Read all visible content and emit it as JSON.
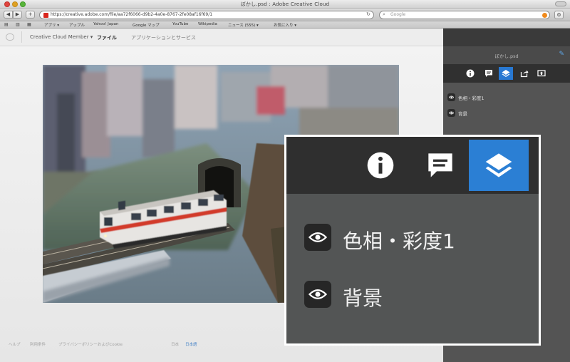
{
  "window": {
    "title": "ぼかし.psd : Adobe Creative Cloud"
  },
  "browser": {
    "url": "https://creative.adobe.com/file/aa72f6066-d9b2-4a0e-8767-2fe08af16f69/1",
    "search_placeholder": "Google"
  },
  "bookmarks": [
    "アプリ ▾",
    "アップル",
    "Yahoo! Japan",
    "Google マップ",
    "YouTube",
    "Wikipedia",
    "ニュース (555) ▾",
    "お気に入り ▾"
  ],
  "app": {
    "title": "Creative Cloud Member ▾",
    "tabs": [
      "ファイル",
      "アプリケーションとサービス"
    ]
  },
  "footer": {
    "links": [
      "ヘルプ",
      "利用条件",
      "プライバシーポリシーおよびCookie ",
      "日本",
      "日本語"
    ]
  },
  "panel": {
    "file_name": "ぼかし.psd",
    "layers": [
      {
        "name": "色相・彩度1"
      },
      {
        "name": "背景"
      }
    ]
  },
  "icons": {
    "info": "info-icon",
    "comment": "comment-icon",
    "layers": "layers-icon",
    "share": "share-icon",
    "export": "export-icon",
    "eye": "eye-icon",
    "edit": "pencil-icon"
  },
  "colors": {
    "accent": "#2b7fd4",
    "panel_bg": "#545454",
    "panel_tabs_bg": "#303030"
  }
}
